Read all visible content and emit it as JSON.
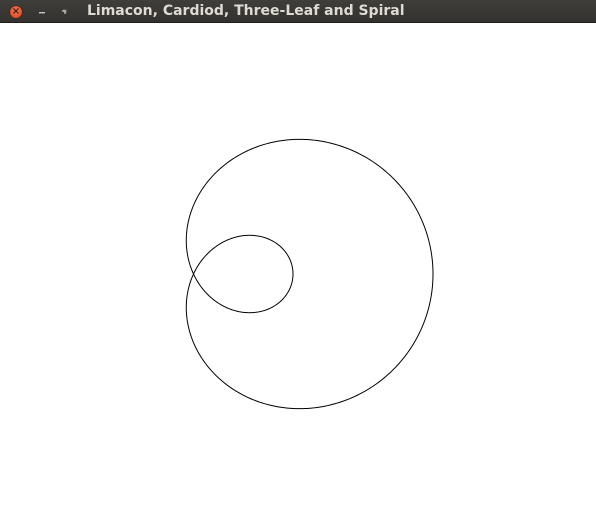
{
  "window": {
    "title": "Limacon, Cardiod, Three-Leaf and Spiral",
    "close_glyph": "×",
    "controls": [
      "close-icon",
      "minimize-icon",
      "maximize-icon"
    ]
  },
  "drawing": {
    "curve": "limacon",
    "stroke_color": "#000000",
    "background_color": "#ffffff"
  },
  "colors": {
    "titlebar": "#3c3b37",
    "title_text": "#dfdbd2",
    "close_button": "#e25a31"
  }
}
